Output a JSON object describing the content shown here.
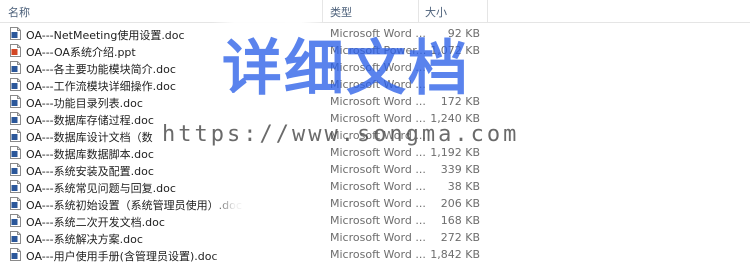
{
  "header": {
    "name_label": "名称",
    "type_label": "类型",
    "size_label": "大小"
  },
  "files": [
    {
      "name": "OA---NetMeeting使用设置.doc",
      "type": "Microsoft Word ...",
      "size": "92 KB",
      "icon": "word-doc-icon"
    },
    {
      "name": "OA---OA系统介绍.ppt",
      "type": "Microsoft Power...",
      "size": "1,072 KB",
      "icon": "powerpoint-icon"
    },
    {
      "name": "OA---各主要功能模块简介.doc",
      "type": "Microsoft Word ...",
      "size": "",
      "icon": "word-doc-icon"
    },
    {
      "name": "OA---工作流模块详细操作.doc",
      "type": "Microsoft Word ...",
      "size": "",
      "icon": "word-doc-icon"
    },
    {
      "name": "OA---功能目录列表.doc",
      "type": "Microsoft Word ...",
      "size": "172 KB",
      "icon": "word-doc-icon"
    },
    {
      "name": "OA---数据库存储过程.doc",
      "type": "Microsoft Word ...",
      "size": "1,240 KB",
      "icon": "word-doc-icon"
    },
    {
      "name": "OA---数据库设计文档（数",
      "type": "Microsoft Word ...",
      "size": "",
      "icon": "word-doc-icon"
    },
    {
      "name": "OA---数据库数据脚本.doc",
      "type": "Microsoft Word ...",
      "size": "1,192 KB",
      "icon": "word-doc-icon"
    },
    {
      "name": "OA---系统安装及配置.doc",
      "type": "Microsoft Word ...",
      "size": "339 KB",
      "icon": "word-doc-icon"
    },
    {
      "name": "OA---系统常见问题与回复.doc",
      "type": "Microsoft Word ...",
      "size": "38 KB",
      "icon": "word-doc-icon"
    },
    {
      "name": "OA---系统初始设置（系统管理员使用）.doc",
      "type": "Microsoft Word ...",
      "size": "206 KB",
      "icon": "word-doc-icon"
    },
    {
      "name": "OA---系统二次开发文档.doc",
      "type": "Microsoft Word ...",
      "size": "168 KB",
      "icon": "word-doc-icon"
    },
    {
      "name": "OA---系统解决方案.doc",
      "type": "Microsoft Word ...",
      "size": "272 KB",
      "icon": "word-doc-icon"
    },
    {
      "name": "OA---用户使用手册(含管理员设置).doc",
      "type": "Microsoft Word ...",
      "size": "1,842 KB",
      "icon": "word-doc-icon"
    }
  ],
  "watermark": {
    "title": "详细文档",
    "url": "https://www.songma.com"
  },
  "colors": {
    "watermark_blue": "#2c60e8",
    "word_icon": "#2b579a",
    "ppt_icon": "#d24726"
  }
}
